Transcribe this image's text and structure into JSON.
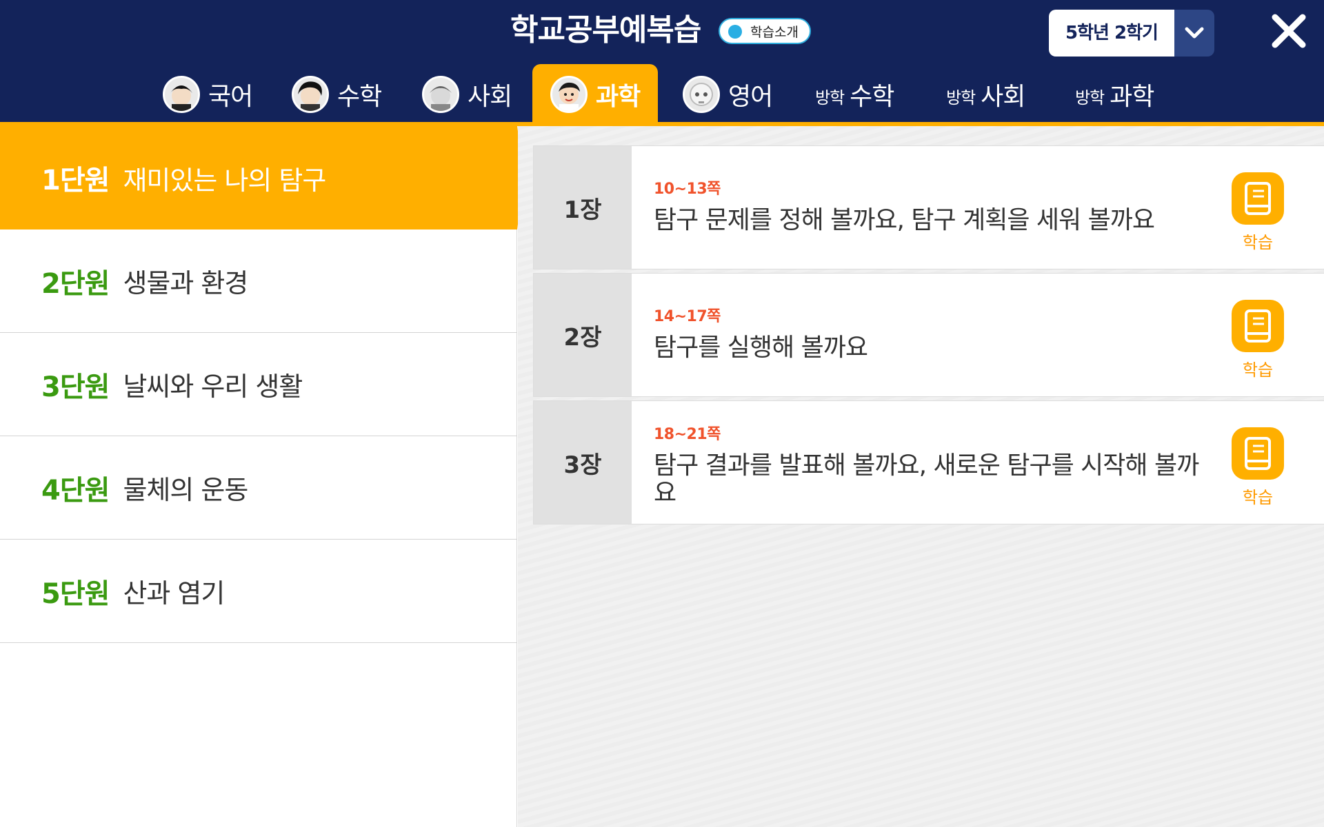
{
  "header": {
    "title": "학교공부예복습",
    "intro_label": "학습소개",
    "grade": "5학년 2학기",
    "colors": {
      "navy": "#13235a",
      "accent": "#ffaf00",
      "green": "#3a9a10",
      "page_red": "#f0522b"
    }
  },
  "tabs": [
    {
      "label": "국어",
      "icon": "korean-teacher-avatar"
    },
    {
      "label": "수학",
      "icon": "math-teacher-avatar"
    },
    {
      "label": "사회",
      "icon": "social-teacher-avatar"
    },
    {
      "label": "과학",
      "icon": "science-teacher-avatar",
      "active": true
    },
    {
      "label": "영어",
      "icon": "robot-avatar"
    },
    {
      "prefix": "방학",
      "label": "수학"
    },
    {
      "prefix": "방학",
      "label": "사회"
    },
    {
      "prefix": "방학",
      "label": "과학"
    }
  ],
  "units": [
    {
      "num": "1단원",
      "name": "재미있는 나의 탐구",
      "active": true
    },
    {
      "num": "2단원",
      "name": "생물과 환경"
    },
    {
      "num": "3단원",
      "name": "날씨와 우리 생활"
    },
    {
      "num": "4단원",
      "name": "물체의 운동"
    },
    {
      "num": "5단원",
      "name": "산과 염기"
    }
  ],
  "lessons": [
    {
      "chapter": "1장",
      "pages": "10~13쪽",
      "title": "탐구 문제를 정해 볼까요, 탐구 계획을 세워 볼까요",
      "button": "학습"
    },
    {
      "chapter": "2장",
      "pages": "14~17쪽",
      "title": "탐구를 실행해 볼까요",
      "button": "학습"
    },
    {
      "chapter": "3장",
      "pages": "18~21쪽",
      "title": "탐구 결과를 발표해 볼까요, 새로운 탐구를 시작해 볼까요",
      "button": "학습"
    }
  ]
}
